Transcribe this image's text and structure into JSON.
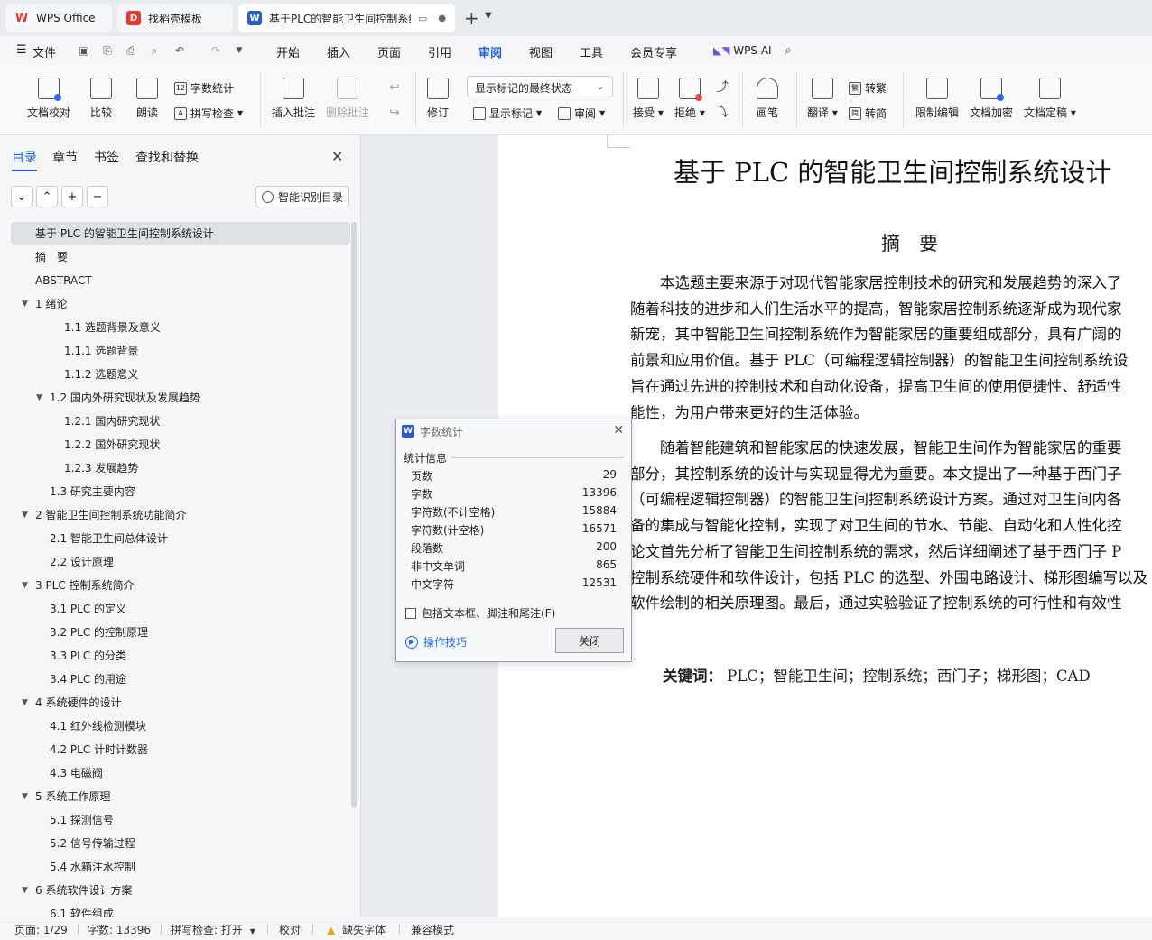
{
  "tabs": [
    {
      "label": "WPS Office",
      "icon": "wps-logo-icon",
      "color": "#e8372c"
    },
    {
      "label": "找稻壳模板",
      "icon": "docer-logo-icon",
      "color": "#e8372c"
    },
    {
      "label": "基于PLC的智能卫生间控制系统",
      "icon": "word-doc-icon",
      "color": "#2a5bd7"
    }
  ],
  "menu": {
    "file": "文件",
    "items": [
      "开始",
      "插入",
      "页面",
      "引用",
      "审阅",
      "视图",
      "工具",
      "会员专享"
    ],
    "active": "审阅",
    "wps_ai": "WPS AI"
  },
  "ribbon": {
    "doc_proof": "文档校对",
    "compare": "比较",
    "read_aloud": "朗读",
    "word_count": "字数统计",
    "spell_check": "拼写检查",
    "insert_comment": "插入批注",
    "delete_comment": "删除批注",
    "track_changes": "修订",
    "markup_view": "显示标记的最终状态",
    "show_markup": "显示标记",
    "review_pane": "审阅",
    "accept": "接受",
    "reject": "拒绝",
    "pen": "画笔",
    "translate": "翻译",
    "to_traditional": "转繁",
    "to_simplified": "转简",
    "restrict_edit": "限制编辑",
    "encrypt": "文档加密",
    "finalize": "文档定稿"
  },
  "nav": {
    "tabs": [
      "目录",
      "章节",
      "书签",
      "查找和替换"
    ],
    "active_tab": "目录",
    "smart_toc": "智能识别目录",
    "outline": [
      {
        "text": "基于 PLC 的智能卫生间控制系统设计",
        "level": 0,
        "selected": true
      },
      {
        "text": "摘　要",
        "level": 0
      },
      {
        "text": "ABSTRACT",
        "level": 0
      },
      {
        "text": "1  绪论",
        "level": 0,
        "expanded": true
      },
      {
        "text": "1.1  选题背景及意义",
        "level": 2
      },
      {
        "text": "1.1.1  选题背景",
        "level": 2
      },
      {
        "text": "1.1.2  选题意义",
        "level": 2
      },
      {
        "text": "1.2  国内外研究现状及发展趋势",
        "level": 1,
        "expanded": true
      },
      {
        "text": "1.2.1  国内研究现状",
        "level": 2
      },
      {
        "text": "1.2.2  国外研究现状",
        "level": 2
      },
      {
        "text": "1.2.3  发展趋势",
        "level": 2
      },
      {
        "text": "1.3 研究主要内容",
        "level": 1
      },
      {
        "text": "2  智能卫生间控制系统功能简介",
        "level": 0,
        "expanded": true
      },
      {
        "text": "2.1 智能卫生间总体设计",
        "level": 1
      },
      {
        "text": "2.2 设计原理",
        "level": 1
      },
      {
        "text": "3 PLC 控制系统简介",
        "level": 0,
        "expanded": true
      },
      {
        "text": "3.1 PLC 的定义",
        "level": 1
      },
      {
        "text": "3.2 PLC 的控制原理",
        "level": 1
      },
      {
        "text": "3.3 PLC 的分类",
        "level": 1
      },
      {
        "text": "3.4 PLC 的用途",
        "level": 1
      },
      {
        "text": "4  系统硬件的设计",
        "level": 0,
        "expanded": true
      },
      {
        "text": "4.1  红外线检测模块",
        "level": 1
      },
      {
        "text": "4.2 PLC 计时计数器",
        "level": 1
      },
      {
        "text": "4.3  电磁阀",
        "level": 1
      },
      {
        "text": "5  系统工作原理",
        "level": 0,
        "expanded": true
      },
      {
        "text": "5.1  探测信号",
        "level": 1
      },
      {
        "text": "5.2  信号传输过程",
        "level": 1
      },
      {
        "text": "5.4  水箱注水控制",
        "level": 1
      },
      {
        "text": "6  系统软件设计方案",
        "level": 0,
        "expanded": true
      },
      {
        "text": "6.1  软件组成",
        "level": 1
      }
    ]
  },
  "document": {
    "title": "基于 PLC 的智能卫生间控制系统设计",
    "abstract_heading": "摘　要",
    "lines": [
      "　　本选题主要来源于对现代智能家居控制技术的研究和发展趋势的深入了",
      "随着科技的进步和人们生活水平的提高，智能家居控制系统逐渐成为现代家",
      "新宠，其中智能卫生间控制系统作为智能家居的重要组成部分，具有广阔的",
      "前景和应用价值。基于 PLC（可编程逻辑控制器）的智能卫生间控制系统设",
      "旨在通过先进的控制技术和自动化设备，提高卫生间的使用便捷性、舒适性",
      "能性，为用户带来更好的生活体验。",
      "　　随着智能建筑和智能家居的快速发展，智能卫生间作为智能家居的重要",
      "部分，其控制系统的设计与实现显得尤为重要。本文提出了一种基于西门子",
      "（可编程逻辑控制器）的智能卫生间控制系统设计方案。通过对卫生间内各",
      "备的集成与智能化控制，实现了对卫生间的节水、节能、自动化和人性化控",
      "论文首先分析了智能卫生间控制系统的需求，然后详细阐述了基于西门子 P",
      "控制系统硬件和软件设计，包括 PLC 的选型、外围电路设计、梯形图编写以及",
      "软件绘制的相关原理图。最后，通过实验验证了控制系统的可行性和有效性"
    ],
    "keywords_label": "关键词：",
    "keywords": "PLC；智能卫生间；控制系统；西门子；梯形图；CAD"
  },
  "dialog": {
    "title": "字数统计",
    "section": "统计信息",
    "stats": [
      {
        "label": "页数",
        "value": "29"
      },
      {
        "label": "字数",
        "value": "13396"
      },
      {
        "label": "字符数(不计空格)",
        "value": "15884"
      },
      {
        "label": "字符数(计空格)",
        "value": "16571"
      },
      {
        "label": "段落数",
        "value": "200"
      },
      {
        "label": "非中文单词",
        "value": "865"
      },
      {
        "label": "中文字符",
        "value": "12531"
      }
    ],
    "include_label": "包括文本框、脚注和尾注(F)",
    "tips": "操作技巧",
    "close": "关闭"
  },
  "status": {
    "page": "页面: 1/29",
    "words": "字数: 13396",
    "spell": "拼写检查: 打开",
    "proof": "校对",
    "missing_font": "缺失字体",
    "compat": "兼容模式"
  }
}
